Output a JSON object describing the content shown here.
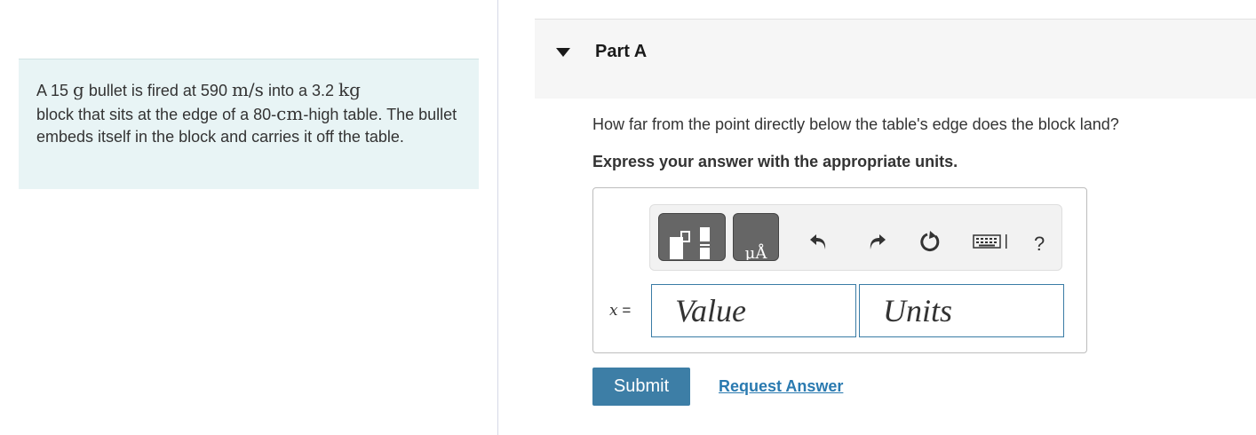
{
  "problem": {
    "seg1": "A 15 ",
    "m1": "g",
    "seg2": " bullet is fired at 590 ",
    "m2": "m/s",
    "seg3": " into a 3.2 ",
    "m3": "kg",
    "seg4": "block that sits at the edge of a 80-",
    "m4": "cm",
    "seg5": "-high table. The bullet embeds itself in the block and carries it off the table."
  },
  "part": {
    "title": "Part A"
  },
  "question": {
    "text": "How far from the point directly below the table's edge does the block land?",
    "instruction": "Express your answer with the appropriate units."
  },
  "toolbar": {
    "units_glyph": "μÅ",
    "help_label": "?",
    "icons": [
      "templates-icon",
      "units-icon",
      "undo-icon",
      "redo-icon",
      "reset-icon",
      "keyboard-icon",
      "help-icon"
    ]
  },
  "answer": {
    "variable": "x",
    "equals": " =",
    "value_placeholder": "Value",
    "units_placeholder": "Units"
  },
  "actions": {
    "submit_label": "Submit",
    "request_label": "Request Answer"
  },
  "colors": {
    "problem_bg": "#e8f4f5",
    "header_bg": "#f6f6f6",
    "submit_bg": "#3d7ea6",
    "link": "#2a7ab0",
    "input_border": "#3a7ca5"
  }
}
